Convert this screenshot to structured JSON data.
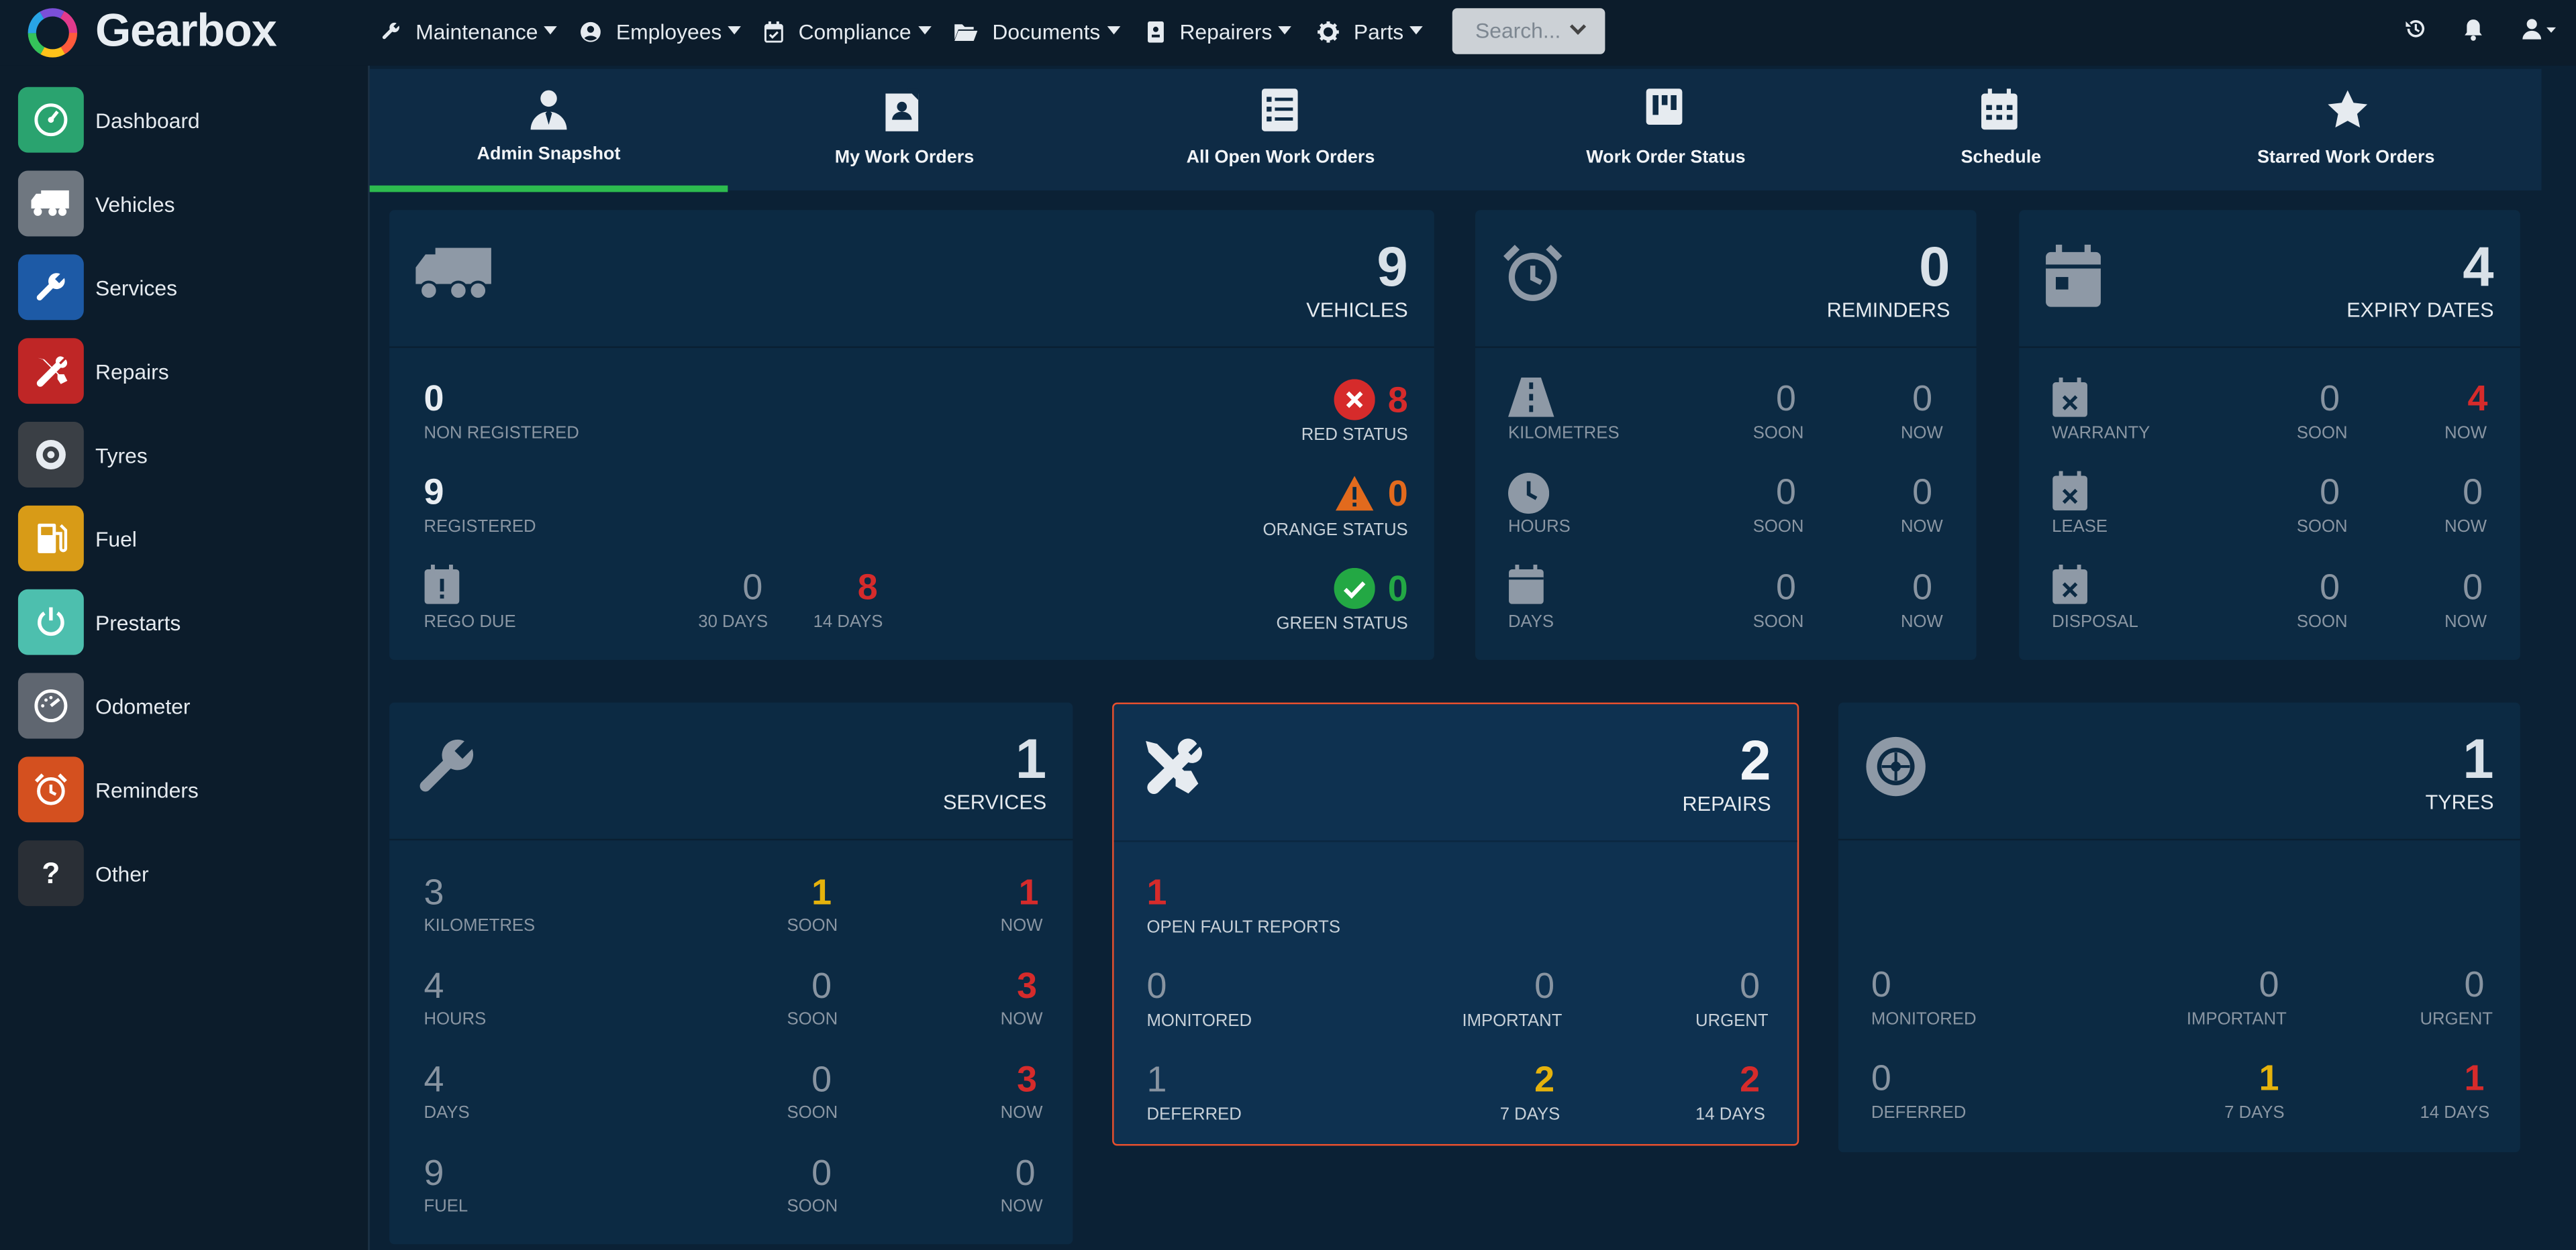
{
  "app": {
    "brand": "Gearbox"
  },
  "topnav": [
    {
      "label": "Maintenance",
      "icon": "wrench-icon"
    },
    {
      "label": "Employees",
      "icon": "user-circle-icon"
    },
    {
      "label": "Compliance",
      "icon": "calendar-check-icon"
    },
    {
      "label": "Documents",
      "icon": "folder-open-icon"
    },
    {
      "label": "Repairers",
      "icon": "id-card-icon"
    },
    {
      "label": "Parts",
      "icon": "gear-icon"
    }
  ],
  "search": {
    "placeholder": "Search..."
  },
  "sidebar": [
    {
      "label": "Dashboard",
      "icon": "dashboard-gauge-icon",
      "color": "#2aa36f"
    },
    {
      "label": "Vehicles",
      "icon": "truck-icon",
      "color": "#6f7780"
    },
    {
      "label": "Services",
      "icon": "wrench-icon",
      "color": "#1d5aa6"
    },
    {
      "label": "Repairs",
      "icon": "tools-icon",
      "color": "#bf2626"
    },
    {
      "label": "Tyres",
      "icon": "tyre-icon",
      "color": "#3a3f45"
    },
    {
      "label": "Fuel",
      "icon": "fuel-pump-icon",
      "color": "#d89b17"
    },
    {
      "label": "Prestarts",
      "icon": "power-icon",
      "color": "#4dbfae"
    },
    {
      "label": "Odometer",
      "icon": "odometer-icon",
      "color": "#5f6670"
    },
    {
      "label": "Reminders",
      "icon": "alarm-clock-icon",
      "color": "#d4501f"
    },
    {
      "label": "Other",
      "icon": "question-icon",
      "color": "#2a2f36"
    }
  ],
  "tabs": [
    {
      "label": "Admin Snapshot",
      "icon": "user-tie-icon",
      "active": true
    },
    {
      "label": "My Work Orders",
      "icon": "clipboard-user-icon"
    },
    {
      "label": "All Open Work Orders",
      "icon": "checklist-icon"
    },
    {
      "label": "Work Order Status",
      "icon": "kanban-icon"
    },
    {
      "label": "Schedule",
      "icon": "calendar-grid-icon"
    },
    {
      "label": "Starred Work Orders",
      "icon": "star-icon"
    }
  ],
  "vehicles": {
    "count": "9",
    "caption": "VEHICLES",
    "non_registered": {
      "value": "0",
      "label": "NON REGISTERED"
    },
    "registered": {
      "value": "9",
      "label": "REGISTERED"
    },
    "rego_due": {
      "label": "REGO DUE",
      "d30": "0",
      "d30_label": "30 DAYS",
      "d14": "8",
      "d14_label": "14 DAYS"
    },
    "red": {
      "value": "8",
      "label": "RED STATUS",
      "color": "#d62b2b"
    },
    "orange": {
      "value": "0",
      "label": "ORANGE STATUS",
      "color": "#e26a1d"
    },
    "green": {
      "value": "0",
      "label": "GREEN STATUS",
      "color": "#23a844"
    }
  },
  "reminders": {
    "count": "0",
    "caption": "REMINDERS",
    "rows": [
      {
        "label": "KILOMETRES",
        "soon": "0",
        "now": "0"
      },
      {
        "label": "HOURS",
        "soon": "0",
        "now": "0"
      },
      {
        "label": "DAYS",
        "soon": "0",
        "now": "0"
      }
    ],
    "soon_label": "SOON",
    "now_label": "NOW"
  },
  "expiry": {
    "count": "4",
    "caption": "EXPIRY DATES",
    "rows": [
      {
        "label": "WARRANTY",
        "soon": "0",
        "now": "4"
      },
      {
        "label": "LEASE",
        "soon": "0",
        "now": "0"
      },
      {
        "label": "DISPOSAL",
        "soon": "0",
        "now": "0"
      }
    ],
    "soon_label": "SOON",
    "now_label": "NOW"
  },
  "services": {
    "count": "1",
    "caption": "SERVICES",
    "rows": [
      {
        "value": "3",
        "label": "KILOMETRES",
        "soon": "1",
        "now": "1"
      },
      {
        "value": "4",
        "label": "HOURS",
        "soon": "0",
        "now": "3"
      },
      {
        "value": "4",
        "label": "DAYS",
        "soon": "0",
        "now": "3"
      },
      {
        "value": "9",
        "label": "FUEL",
        "soon": "0",
        "now": "0"
      }
    ],
    "soon_label": "SOON",
    "now_label": "NOW"
  },
  "repairs": {
    "count": "2",
    "caption": "REPAIRS",
    "fault": {
      "value": "1",
      "label": "OPEN FAULT REPORTS"
    },
    "monitored": {
      "value": "0",
      "label": "MONITORED"
    },
    "important": {
      "value": "0",
      "label": "IMPORTANT"
    },
    "urgent": {
      "value": "0",
      "label": "URGENT"
    },
    "deferred": {
      "value": "1",
      "label": "DEFERRED"
    },
    "d7": {
      "value": "2",
      "label": "7 DAYS"
    },
    "d14": {
      "value": "2",
      "label": "14 DAYS"
    },
    "highlight_color": "#e8502e"
  },
  "tyres": {
    "count": "1",
    "caption": "TYRES",
    "monitored": {
      "value": "0",
      "label": "MONITORED"
    },
    "important": {
      "value": "0",
      "label": "IMPORTANT"
    },
    "urgent": {
      "value": "0",
      "label": "URGENT"
    },
    "deferred": {
      "value": "0",
      "label": "DEFERRED"
    },
    "d7": {
      "value": "1",
      "label": "7 DAYS"
    },
    "d14": {
      "value": "1",
      "label": "14 DAYS"
    }
  }
}
